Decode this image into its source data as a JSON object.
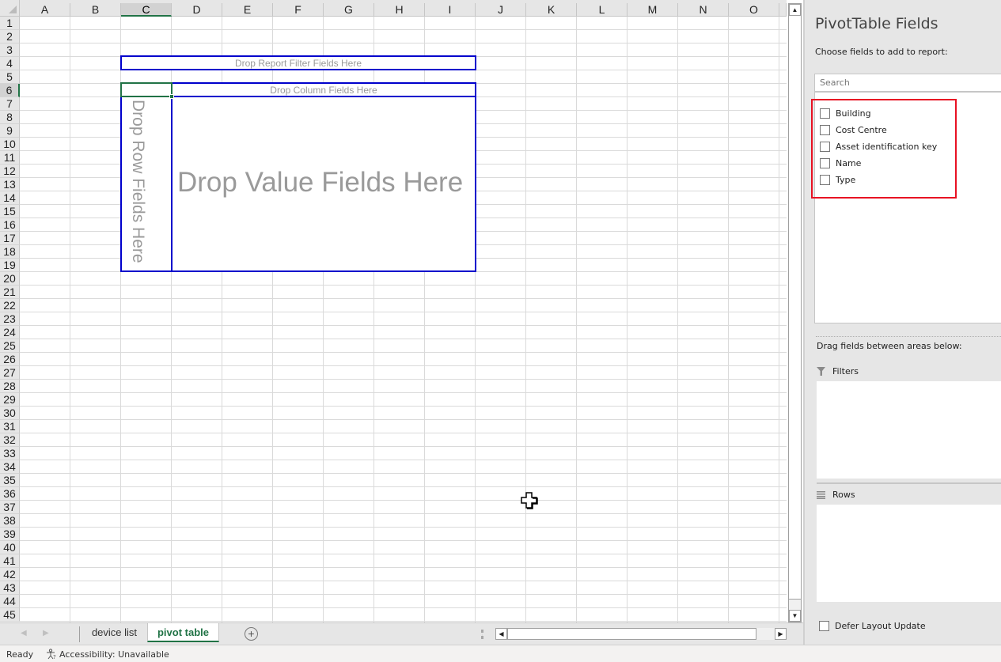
{
  "grid": {
    "columns": [
      "A",
      "B",
      "C",
      "D",
      "E",
      "F",
      "G",
      "H",
      "I",
      "J",
      "K",
      "L",
      "M",
      "N",
      "O"
    ],
    "selected_column": "C",
    "rows": [
      1,
      2,
      3,
      4,
      5,
      6,
      7,
      8,
      9,
      10,
      11,
      12,
      13,
      14,
      15,
      16,
      17,
      18,
      19,
      20,
      21,
      22,
      23,
      24,
      25,
      26,
      27,
      28,
      29,
      30,
      31,
      32,
      33,
      34,
      35,
      36,
      37,
      38,
      39,
      40,
      41,
      42,
      43,
      44,
      45
    ],
    "selected_row": 6,
    "selected_cell": "C6"
  },
  "pivot_placeholder": {
    "report_filter": "Drop Report Filter Fields Here",
    "column_fields": "Drop Column Fields Here",
    "row_fields": "Drop Row Fields Here",
    "value_fields": "Drop Value Fields Here",
    "border_color": "#0000cc"
  },
  "sheet_tabs": {
    "prev_icon": "◀",
    "next_icon": "▶",
    "tabs": [
      {
        "label": "device list",
        "active": false
      },
      {
        "label": "pivot table",
        "active": true
      }
    ],
    "add_sheet_icon": "+"
  },
  "status_bar": {
    "ready": "Ready",
    "accessibility": "Accessibility: Unavailable"
  },
  "pivot_panel": {
    "title": "PivotTable Fields",
    "subtitle": "Choose fields to add to report:",
    "search_placeholder": "Search",
    "fields": [
      {
        "label": "Building",
        "checked": false
      },
      {
        "label": "Cost Centre",
        "checked": false
      },
      {
        "label": "Asset identification key",
        "checked": false
      },
      {
        "label": "Name",
        "checked": false
      },
      {
        "label": "Type",
        "checked": false
      }
    ],
    "highlight_color": "#e81123",
    "drag_label": "Drag fields between areas below:",
    "areas": [
      {
        "label": "Filters",
        "icon": "filter-icon"
      },
      {
        "label": "Rows",
        "icon": "rows-icon"
      }
    ],
    "defer_label": "Defer Layout Update",
    "defer_checked": false
  },
  "colors": {
    "accent": "#217346",
    "header_bg": "#e6e6e6",
    "panel_bg": "#e6e6e6"
  }
}
